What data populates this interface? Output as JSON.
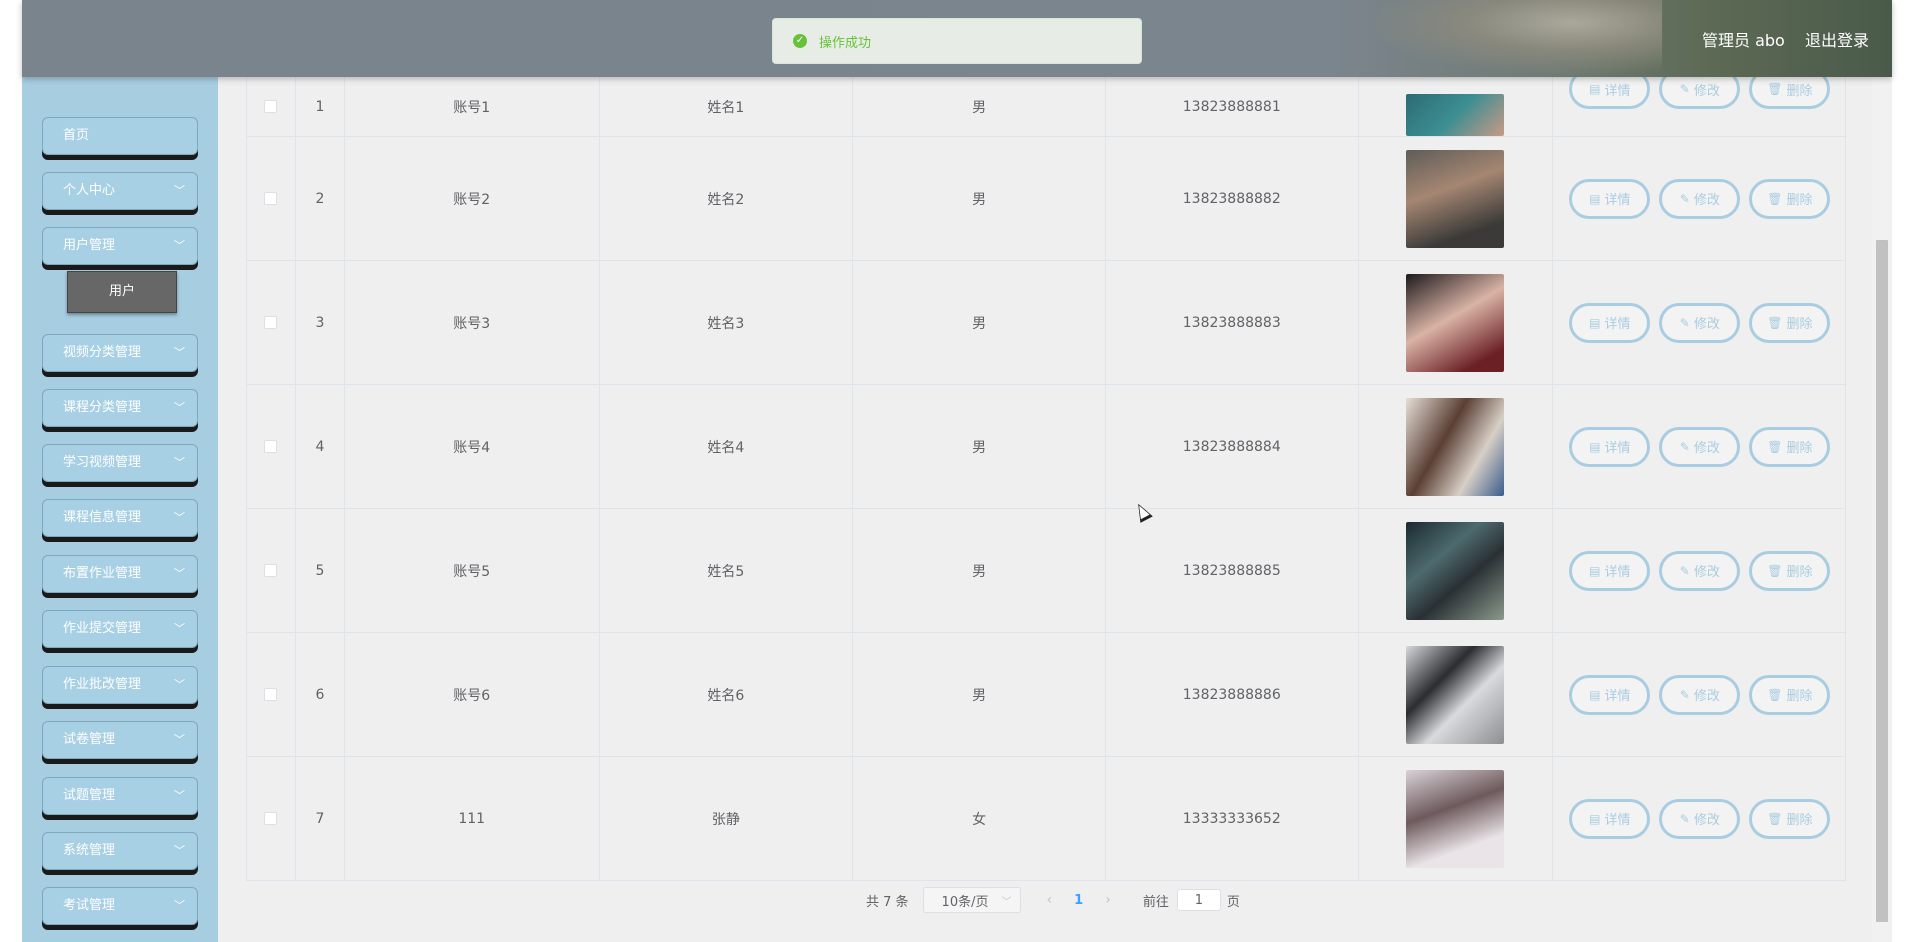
{
  "header": {
    "user_label": "管理员 abo",
    "logout_label": "退出登录"
  },
  "toast": {
    "message": "操作成功",
    "icon": "check-circle-icon"
  },
  "sidebar": {
    "items": [
      {
        "label": "首页",
        "has_chevron": false
      },
      {
        "label": "个人中心",
        "has_chevron": true
      },
      {
        "label": "用户管理",
        "has_chevron": true
      },
      {
        "label": "视频分类管理",
        "has_chevron": true
      },
      {
        "label": "课程分类管理",
        "has_chevron": true
      },
      {
        "label": "学习视频管理",
        "has_chevron": true
      },
      {
        "label": "课程信息管理",
        "has_chevron": true
      },
      {
        "label": "布置作业管理",
        "has_chevron": true
      },
      {
        "label": "作业提交管理",
        "has_chevron": true
      },
      {
        "label": "作业批改管理",
        "has_chevron": true
      },
      {
        "label": "试卷管理",
        "has_chevron": true
      },
      {
        "label": "试题管理",
        "has_chevron": true
      },
      {
        "label": "系统管理",
        "has_chevron": true
      },
      {
        "label": "考试管理",
        "has_chevron": true
      }
    ],
    "active_sub_item": "用户"
  },
  "table": {
    "rows": [
      {
        "index": "1",
        "account": "账号1",
        "name": "姓名1",
        "sex": "男",
        "phone": "13823888881"
      },
      {
        "index": "2",
        "account": "账号2",
        "name": "姓名2",
        "sex": "男",
        "phone": "13823888882"
      },
      {
        "index": "3",
        "account": "账号3",
        "name": "姓名3",
        "sex": "男",
        "phone": "13823888883"
      },
      {
        "index": "4",
        "account": "账号4",
        "name": "姓名4",
        "sex": "男",
        "phone": "13823888884"
      },
      {
        "index": "5",
        "account": "账号5",
        "name": "姓名5",
        "sex": "男",
        "phone": "13823888885"
      },
      {
        "index": "6",
        "account": "账号6",
        "name": "姓名6",
        "sex": "男",
        "phone": "13823888886"
      },
      {
        "index": "7",
        "account": "111",
        "name": "张静",
        "sex": "女",
        "phone": "13333333652"
      }
    ],
    "actions": {
      "view_label": "详情",
      "edit_label": "修改",
      "delete_label": "删除"
    }
  },
  "pager": {
    "total_label": "共 7 条",
    "page_size": "10条/页",
    "current_page": "1",
    "goto_label": "前往",
    "goto_value": "1",
    "page_unit": "页"
  },
  "colors": {
    "accent": "#a9cde0",
    "sidebar_bg": "#a7cde0",
    "success": "#67c23a"
  }
}
